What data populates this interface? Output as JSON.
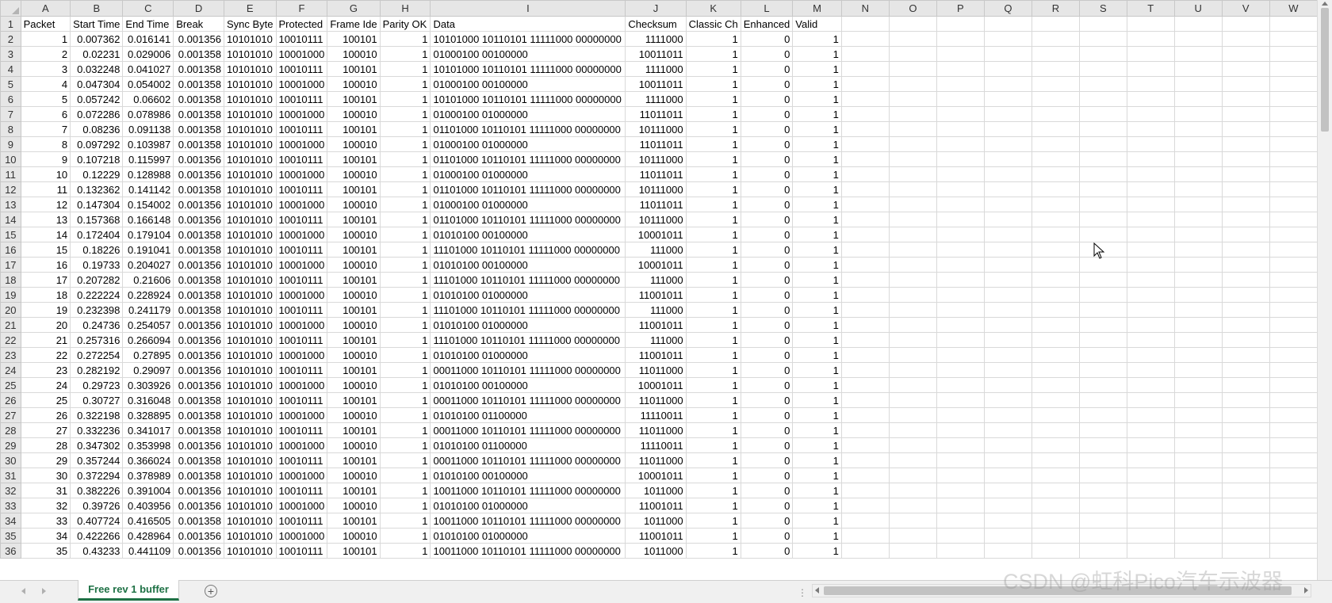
{
  "sheet": {
    "col_letters": [
      "A",
      "B",
      "C",
      "D",
      "E",
      "F",
      "G",
      "H",
      "I",
      "J",
      "K",
      "L",
      "M",
      "N",
      "O",
      "P",
      "Q",
      "R",
      "S",
      "T",
      "U",
      "V",
      "W"
    ],
    "col_types": [
      "num",
      "num",
      "num",
      "num",
      "txt",
      "txt",
      "num",
      "num",
      "txt",
      "num",
      "num",
      "num",
      "num",
      "txt",
      "txt",
      "txt",
      "txt",
      "txt",
      "txt",
      "txt",
      "txt",
      "txt",
      "txt"
    ],
    "rows": [
      {
        "n": "1",
        "cells": [
          "Packet",
          "Start Time",
          "End Time",
          "Break",
          "Sync Byte",
          "Protected",
          "Frame Ide",
          "Parity OK",
          "Data",
          "Checksum",
          "Classic Ch",
          "Enhanced",
          "Valid",
          "",
          "",
          "",
          "",
          "",
          "",
          "",
          "",
          "",
          ""
        ]
      },
      {
        "n": "2",
        "cells": [
          "1",
          "0.007362",
          "0.016141",
          "0.001356",
          "10101010",
          "10010111",
          "100101",
          "1",
          "10101000 10110101 11111000 00000000",
          "1111000",
          "1",
          "0",
          "1",
          "",
          "",
          "",
          "",
          "",
          "",
          "",
          "",
          "",
          ""
        ]
      },
      {
        "n": "3",
        "cells": [
          "2",
          "0.02231",
          "0.029006",
          "0.001358",
          "10101010",
          "10001000",
          "100010",
          "1",
          "01000100 00100000",
          "10011011",
          "1",
          "0",
          "1",
          "",
          "",
          "",
          "",
          "",
          "",
          "",
          "",
          "",
          ""
        ]
      },
      {
        "n": "4",
        "cells": [
          "3",
          "0.032248",
          "0.041027",
          "0.001358",
          "10101010",
          "10010111",
          "100101",
          "1",
          "10101000 10110101 11111000 00000000",
          "1111000",
          "1",
          "0",
          "1",
          "",
          "",
          "",
          "",
          "",
          "",
          "",
          "",
          "",
          ""
        ]
      },
      {
        "n": "5",
        "cells": [
          "4",
          "0.047304",
          "0.054002",
          "0.001358",
          "10101010",
          "10001000",
          "100010",
          "1",
          "01000100 00100000",
          "10011011",
          "1",
          "0",
          "1",
          "",
          "",
          "",
          "",
          "",
          "",
          "",
          "",
          "",
          ""
        ]
      },
      {
        "n": "6",
        "cells": [
          "5",
          "0.057242",
          "0.06602",
          "0.001358",
          "10101010",
          "10010111",
          "100101",
          "1",
          "10101000 10110101 11111000 00000000",
          "1111000",
          "1",
          "0",
          "1",
          "",
          "",
          "",
          "",
          "",
          "",
          "",
          "",
          "",
          ""
        ]
      },
      {
        "n": "7",
        "cells": [
          "6",
          "0.072286",
          "0.078986",
          "0.001358",
          "10101010",
          "10001000",
          "100010",
          "1",
          "01000100 01000000",
          "11011011",
          "1",
          "0",
          "1",
          "",
          "",
          "",
          "",
          "",
          "",
          "",
          "",
          "",
          ""
        ]
      },
      {
        "n": "8",
        "cells": [
          "7",
          "0.08236",
          "0.091138",
          "0.001358",
          "10101010",
          "10010111",
          "100101",
          "1",
          "01101000 10110101 11111000 00000000",
          "10111000",
          "1",
          "0",
          "1",
          "",
          "",
          "",
          "",
          "",
          "",
          "",
          "",
          "",
          ""
        ]
      },
      {
        "n": "9",
        "cells": [
          "8",
          "0.097292",
          "0.103987",
          "0.001358",
          "10101010",
          "10001000",
          "100010",
          "1",
          "01000100 01000000",
          "11011011",
          "1",
          "0",
          "1",
          "",
          "",
          "",
          "",
          "",
          "",
          "",
          "",
          "",
          ""
        ]
      },
      {
        "n": "10",
        "cells": [
          "9",
          "0.107218",
          "0.115997",
          "0.001356",
          "10101010",
          "10010111",
          "100101",
          "1",
          "01101000 10110101 11111000 00000000",
          "10111000",
          "1",
          "0",
          "1",
          "",
          "",
          "",
          "",
          "",
          "",
          "",
          "",
          "",
          ""
        ]
      },
      {
        "n": "11",
        "cells": [
          "10",
          "0.12229",
          "0.128988",
          "0.001356",
          "10101010",
          "10001000",
          "100010",
          "1",
          "01000100 01000000",
          "11011011",
          "1",
          "0",
          "1",
          "",
          "",
          "",
          "",
          "",
          "",
          "",
          "",
          "",
          ""
        ]
      },
      {
        "n": "12",
        "cells": [
          "11",
          "0.132362",
          "0.141142",
          "0.001358",
          "10101010",
          "10010111",
          "100101",
          "1",
          "01101000 10110101 11111000 00000000",
          "10111000",
          "1",
          "0",
          "1",
          "",
          "",
          "",
          "",
          "",
          "",
          "",
          "",
          "",
          ""
        ]
      },
      {
        "n": "13",
        "cells": [
          "12",
          "0.147304",
          "0.154002",
          "0.001356",
          "10101010",
          "10001000",
          "100010",
          "1",
          "01000100 01000000",
          "11011011",
          "1",
          "0",
          "1",
          "",
          "",
          "",
          "",
          "",
          "",
          "",
          "",
          "",
          ""
        ]
      },
      {
        "n": "14",
        "cells": [
          "13",
          "0.157368",
          "0.166148",
          "0.001356",
          "10101010",
          "10010111",
          "100101",
          "1",
          "01101000 10110101 11111000 00000000",
          "10111000",
          "1",
          "0",
          "1",
          "",
          "",
          "",
          "",
          "",
          "",
          "",
          "",
          "",
          ""
        ]
      },
      {
        "n": "15",
        "cells": [
          "14",
          "0.172404",
          "0.179104",
          "0.001358",
          "10101010",
          "10001000",
          "100010",
          "1",
          "01010100 00100000",
          "10001011",
          "1",
          "0",
          "1",
          "",
          "",
          "",
          "",
          "",
          "",
          "",
          "",
          "",
          ""
        ]
      },
      {
        "n": "16",
        "cells": [
          "15",
          "0.18226",
          "0.191041",
          "0.001358",
          "10101010",
          "10010111",
          "100101",
          "1",
          "11101000 10110101 11111000 00000000",
          "111000",
          "1",
          "0",
          "1",
          "",
          "",
          "",
          "",
          "",
          "",
          "",
          "",
          "",
          ""
        ]
      },
      {
        "n": "17",
        "cells": [
          "16",
          "0.19733",
          "0.204027",
          "0.001356",
          "10101010",
          "10001000",
          "100010",
          "1",
          "01010100 00100000",
          "10001011",
          "1",
          "0",
          "1",
          "",
          "",
          "",
          "",
          "",
          "",
          "",
          "",
          "",
          ""
        ]
      },
      {
        "n": "18",
        "cells": [
          "17",
          "0.207282",
          "0.21606",
          "0.001358",
          "10101010",
          "10010111",
          "100101",
          "1",
          "11101000 10110101 11111000 00000000",
          "111000",
          "1",
          "0",
          "1",
          "",
          "",
          "",
          "",
          "",
          "",
          "",
          "",
          "",
          ""
        ]
      },
      {
        "n": "19",
        "cells": [
          "18",
          "0.222224",
          "0.228924",
          "0.001358",
          "10101010",
          "10001000",
          "100010",
          "1",
          "01010100 01000000",
          "11001011",
          "1",
          "0",
          "1",
          "",
          "",
          "",
          "",
          "",
          "",
          "",
          "",
          "",
          ""
        ]
      },
      {
        "n": "20",
        "cells": [
          "19",
          "0.232398",
          "0.241179",
          "0.001358",
          "10101010",
          "10010111",
          "100101",
          "1",
          "11101000 10110101 11111000 00000000",
          "111000",
          "1",
          "0",
          "1",
          "",
          "",
          "",
          "",
          "",
          "",
          "",
          "",
          "",
          ""
        ]
      },
      {
        "n": "21",
        "cells": [
          "20",
          "0.24736",
          "0.254057",
          "0.001356",
          "10101010",
          "10001000",
          "100010",
          "1",
          "01010100 01000000",
          "11001011",
          "1",
          "0",
          "1",
          "",
          "",
          "",
          "",
          "",
          "",
          "",
          "",
          "",
          ""
        ]
      },
      {
        "n": "22",
        "cells": [
          "21",
          "0.257316",
          "0.266094",
          "0.001356",
          "10101010",
          "10010111",
          "100101",
          "1",
          "11101000 10110101 11111000 00000000",
          "111000",
          "1",
          "0",
          "1",
          "",
          "",
          "",
          "",
          "",
          "",
          "",
          "",
          "",
          ""
        ]
      },
      {
        "n": "23",
        "cells": [
          "22",
          "0.272254",
          "0.27895",
          "0.001356",
          "10101010",
          "10001000",
          "100010",
          "1",
          "01010100 01000000",
          "11001011",
          "1",
          "0",
          "1",
          "",
          "",
          "",
          "",
          "",
          "",
          "",
          "",
          "",
          ""
        ]
      },
      {
        "n": "24",
        "cells": [
          "23",
          "0.282192",
          "0.29097",
          "0.001356",
          "10101010",
          "10010111",
          "100101",
          "1",
          "00011000 10110101 11111000 00000000",
          "11011000",
          "1",
          "0",
          "1",
          "",
          "",
          "",
          "",
          "",
          "",
          "",
          "",
          "",
          ""
        ]
      },
      {
        "n": "25",
        "cells": [
          "24",
          "0.29723",
          "0.303926",
          "0.001356",
          "10101010",
          "10001000",
          "100010",
          "1",
          "01010100 00100000",
          "10001011",
          "1",
          "0",
          "1",
          "",
          "",
          "",
          "",
          "",
          "",
          "",
          "",
          "",
          ""
        ]
      },
      {
        "n": "26",
        "cells": [
          "25",
          "0.30727",
          "0.316048",
          "0.001358",
          "10101010",
          "10010111",
          "100101",
          "1",
          "00011000 10110101 11111000 00000000",
          "11011000",
          "1",
          "0",
          "1",
          "",
          "",
          "",
          "",
          "",
          "",
          "",
          "",
          "",
          ""
        ]
      },
      {
        "n": "27",
        "cells": [
          "26",
          "0.322198",
          "0.328895",
          "0.001358",
          "10101010",
          "10001000",
          "100010",
          "1",
          "01010100 01100000",
          "11110011",
          "1",
          "0",
          "1",
          "",
          "",
          "",
          "",
          "",
          "",
          "",
          "",
          "",
          ""
        ]
      },
      {
        "n": "28",
        "cells": [
          "27",
          "0.332236",
          "0.341017",
          "0.001358",
          "10101010",
          "10010111",
          "100101",
          "1",
          "00011000 10110101 11111000 00000000",
          "11011000",
          "1",
          "0",
          "1",
          "",
          "",
          "",
          "",
          "",
          "",
          "",
          "",
          "",
          ""
        ]
      },
      {
        "n": "29",
        "cells": [
          "28",
          "0.347302",
          "0.353998",
          "0.001356",
          "10101010",
          "10001000",
          "100010",
          "1",
          "01010100 01100000",
          "11110011",
          "1",
          "0",
          "1",
          "",
          "",
          "",
          "",
          "",
          "",
          "",
          "",
          "",
          ""
        ]
      },
      {
        "n": "30",
        "cells": [
          "29",
          "0.357244",
          "0.366024",
          "0.001358",
          "10101010",
          "10010111",
          "100101",
          "1",
          "00011000 10110101 11111000 00000000",
          "11011000",
          "1",
          "0",
          "1",
          "",
          "",
          "",
          "",
          "",
          "",
          "",
          "",
          "",
          ""
        ]
      },
      {
        "n": "31",
        "cells": [
          "30",
          "0.372294",
          "0.378989",
          "0.001358",
          "10101010",
          "10001000",
          "100010",
          "1",
          "01010100 00100000",
          "10001011",
          "1",
          "0",
          "1",
          "",
          "",
          "",
          "",
          "",
          "",
          "",
          "",
          "",
          ""
        ]
      },
      {
        "n": "32",
        "cells": [
          "31",
          "0.382226",
          "0.391004",
          "0.001356",
          "10101010",
          "10010111",
          "100101",
          "1",
          "10011000 10110101 11111000 00000000",
          "1011000",
          "1",
          "0",
          "1",
          "",
          "",
          "",
          "",
          "",
          "",
          "",
          "",
          "",
          ""
        ]
      },
      {
        "n": "33",
        "cells": [
          "32",
          "0.39726",
          "0.403956",
          "0.001356",
          "10101010",
          "10001000",
          "100010",
          "1",
          "01010100 01000000",
          "11001011",
          "1",
          "0",
          "1",
          "",
          "",
          "",
          "",
          "",
          "",
          "",
          "",
          "",
          ""
        ]
      },
      {
        "n": "34",
        "cells": [
          "33",
          "0.407724",
          "0.416505",
          "0.001358",
          "10101010",
          "10010111",
          "100101",
          "1",
          "10011000 10110101 11111000 00000000",
          "1011000",
          "1",
          "0",
          "1",
          "",
          "",
          "",
          "",
          "",
          "",
          "",
          "",
          "",
          ""
        ]
      },
      {
        "n": "35",
        "cells": [
          "34",
          "0.422266",
          "0.428964",
          "0.001356",
          "10101010",
          "10001000",
          "100010",
          "1",
          "01010100 01000000",
          "11001011",
          "1",
          "0",
          "1",
          "",
          "",
          "",
          "",
          "",
          "",
          "",
          "",
          "",
          ""
        ]
      },
      {
        "n": "36",
        "cells": [
          "35",
          "0.43233",
          "0.441109",
          "0.001356",
          "10101010",
          "10010111",
          "100101",
          "1",
          "10011000 10110101 11111000 00000000",
          "1011000",
          "1",
          "0",
          "1",
          "",
          "",
          "",
          "",
          "",
          "",
          "",
          "",
          "",
          ""
        ]
      }
    ]
  },
  "tabs": {
    "active": "Free rev 1 buffer",
    "add_symbol": "+"
  },
  "status": {
    "split_handle": "⋮"
  },
  "watermark": "CSDN @虹科Pico汽车示波器",
  "colors": {
    "accent": "#1e7145",
    "header_bg": "#e6e6e6",
    "gridline": "#d9d9d9"
  },
  "icons": {
    "add_sheet": "plus-circle-icon",
    "cursor": "mouse-pointer-icon"
  }
}
